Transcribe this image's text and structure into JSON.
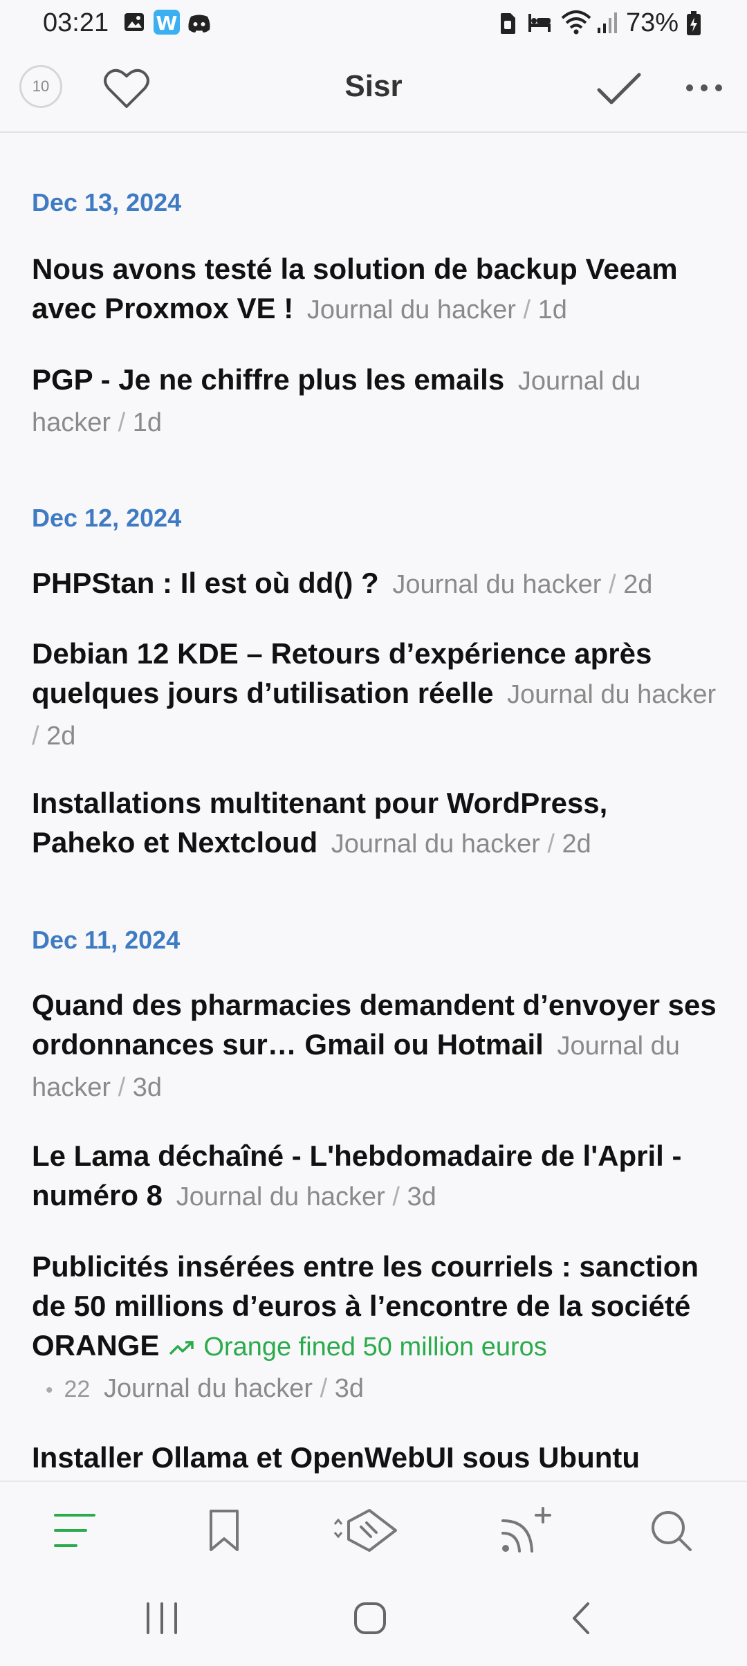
{
  "status_bar": {
    "time": "03:21",
    "battery": "73%",
    "icons": [
      "gallery-icon",
      "app-w-icon",
      "discord-icon",
      "sim-icon",
      "bed-icon",
      "wifi-icon",
      "signal-icon",
      "battery-icon"
    ]
  },
  "toolbar": {
    "counter": "10",
    "title": "Sisr",
    "icons": [
      "heart-icon",
      "check-icon",
      "more-icon"
    ]
  },
  "feed": [
    {
      "date": "Dec 13, 2024",
      "articles": [
        {
          "title": "Nous avons testé la solution de backup Veeam avec Proxmox VE !",
          "source": "Journal du hacker",
          "age": "1d"
        },
        {
          "title": "PGP - Je ne chiffre plus les emails",
          "source": "Journal du hacker",
          "age": "1d"
        }
      ]
    },
    {
      "date": "Dec 12, 2024",
      "articles": [
        {
          "title": "PHPStan : Il est où dd() ?",
          "source": "Journal du hacker",
          "age": "2d"
        },
        {
          "title": "Debian 12 KDE – Retours d’expérience après quelques jours d’utilisation réelle",
          "source": "Journal du hacker",
          "age": "2d"
        },
        {
          "title": "Installations multitenant pour WordPress, Paheko et Nextcloud",
          "source": "Journal du hacker",
          "age": "2d"
        }
      ]
    },
    {
      "date": "Dec 11, 2024",
      "articles": [
        {
          "title": "Quand des pharmacies demandent d’envoyer ses ordonnances sur… Gmail ou Hotmail",
          "source": "Journal du hacker",
          "age": "3d"
        },
        {
          "title": "Le Lama déchaîné - L'hebdomadaire de l'April - numéro 8",
          "source": "Journal du hacker",
          "age": "3d"
        },
        {
          "title": "Publicités insérées entre les courriels : sanction de 50 millions d’euros à l’encontre de la société ORANGE",
          "trend": "Orange fined 50 million euros",
          "count": "22",
          "source": "Journal du hacker",
          "age": "3d"
        },
        {
          "title": "Installer Ollama et OpenWebUI sous Ubuntu"
        }
      ]
    }
  ],
  "bottom_nav": {
    "items": [
      "feed-list-icon",
      "bookmark-icon",
      "discover-icon",
      "add-feed-icon",
      "search-icon"
    ],
    "active_color": "#2bab4b"
  },
  "colors": {
    "date": "#3f7bc2",
    "trend": "#2bab4b",
    "meta": "#8a8a8a"
  }
}
